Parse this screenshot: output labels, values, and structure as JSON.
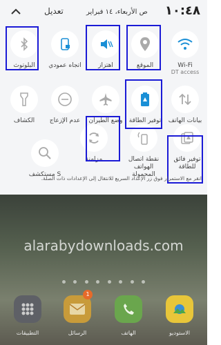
{
  "status": {
    "edit_label": "تعديل",
    "date": "ص الأربعاء، ١٤ فبراير",
    "time": "١٠:٤٨"
  },
  "tiles": [
    {
      "label": "البلوتوث",
      "icon": "bluetooth-icon"
    },
    {
      "label": "اتجاه عمودي",
      "icon": "portrait-lock-icon"
    },
    {
      "label": "اهتزاز",
      "icon": "vibrate-icon"
    },
    {
      "label": "الموقع",
      "icon": "location-icon"
    },
    {
      "label": "Wi-Fi",
      "sub": "DT access",
      "icon": "wifi-icon"
    },
    {
      "label": "الكشاف",
      "icon": "flashlight-icon"
    },
    {
      "label": "عدم الإزعاج",
      "icon": "do-not-disturb-icon"
    },
    {
      "label": "وضع الطيران",
      "icon": "airplane-icon"
    },
    {
      "label": "توفير الطاقة",
      "icon": "battery-saver-icon"
    },
    {
      "label": "بيانات الهاتف",
      "icon": "mobile-data-icon"
    },
    {
      "label": "مستكشف S",
      "icon": "search-icon"
    },
    {
      "label": "مزامنة",
      "icon": "sync-icon"
    },
    {
      "label": "نقطة اتصال الهواتف المحمولة",
      "icon": "hotspot-icon"
    },
    {
      "label": "توفير فائق للطاقة",
      "icon": "ultra-power-saving-icon"
    }
  ],
  "hint": "انقر مع الاستمرار فوق زر الإعداد السريع للانتقال إلى الإعدادات ذات الصلة.",
  "home": {
    "watermark": "alarabydownloads.com",
    "dock": [
      {
        "label": "التطبيقات",
        "icon": "apps-icon"
      },
      {
        "label": "الرسائل",
        "icon": "messages-icon",
        "badge": "1"
      },
      {
        "label": "الهاتف",
        "icon": "phone-icon"
      },
      {
        "label": "الاستوديو",
        "icon": "gallery-icon"
      }
    ]
  },
  "colors": {
    "accent": "#1a8fd6",
    "highlight": "#1a1ad6",
    "panel": "#f4f5f7"
  }
}
